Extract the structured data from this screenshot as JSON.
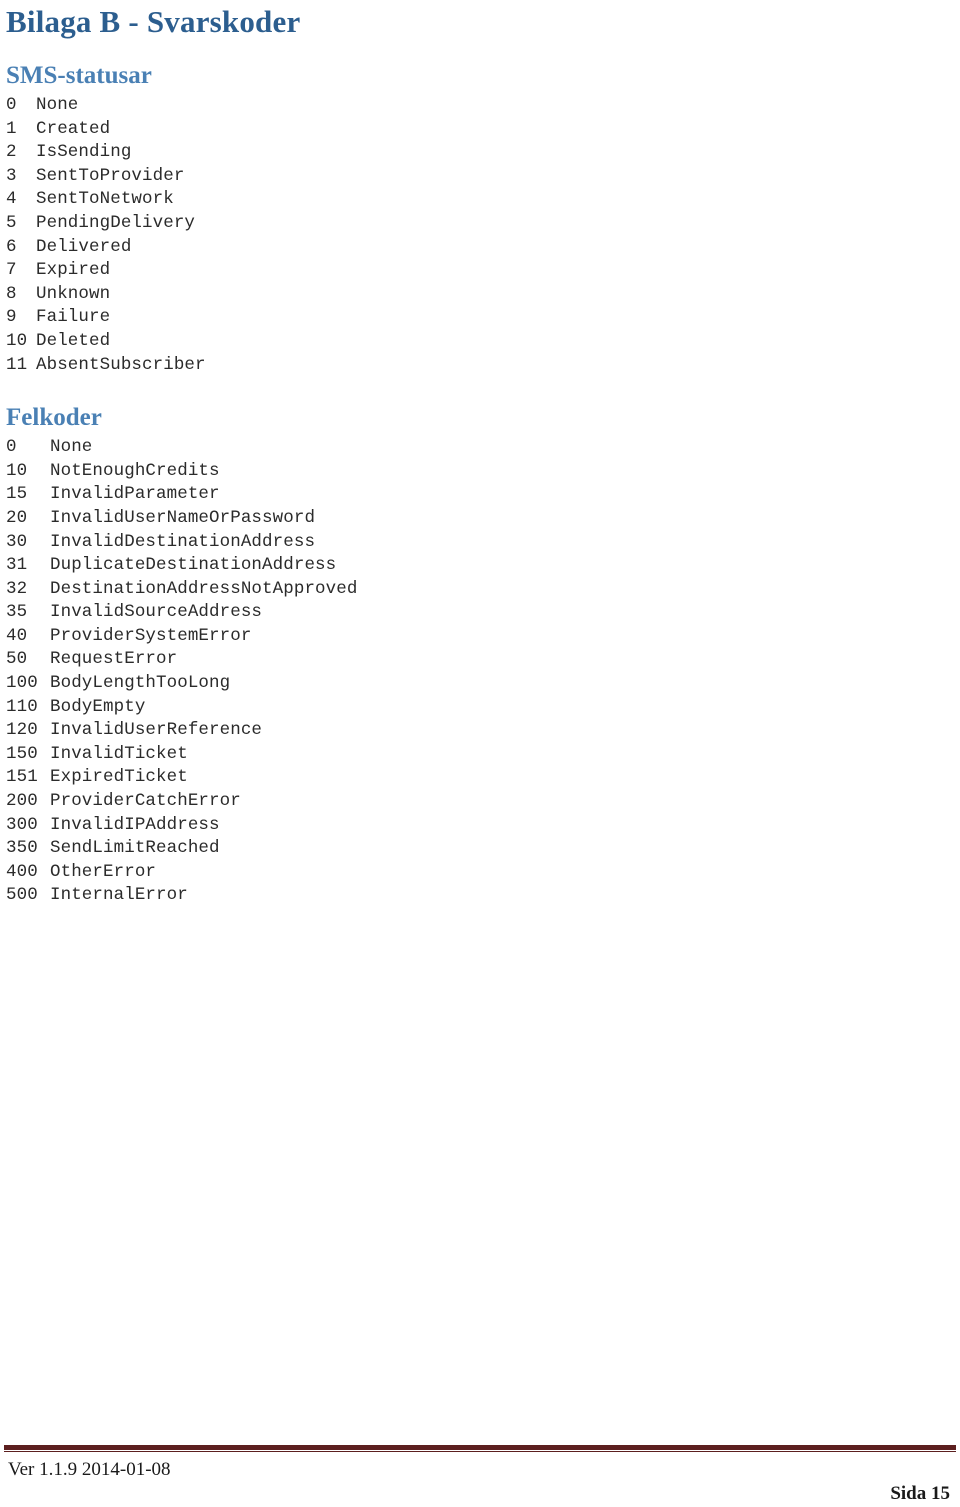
{
  "document": {
    "title": "Bilaga B - Svarskoder",
    "title_color": "#2C5E8F",
    "heading_color": "#4A80B4",
    "rule_color": "#5C1F1F"
  },
  "sections": [
    {
      "id": "sms-statusar",
      "heading": "SMS-statusar",
      "items": [
        {
          "code": "0",
          "label": "None"
        },
        {
          "code": "1",
          "label": "Created"
        },
        {
          "code": "2",
          "label": "IsSending"
        },
        {
          "code": "3",
          "label": "SentToProvider"
        },
        {
          "code": "4",
          "label": "SentToNetwork"
        },
        {
          "code": "5",
          "label": "PendingDelivery"
        },
        {
          "code": "6",
          "label": "Delivered"
        },
        {
          "code": "7",
          "label": "Expired"
        },
        {
          "code": "8",
          "label": "Unknown"
        },
        {
          "code": "9",
          "label": "Failure"
        },
        {
          "code": "10",
          "label": "Deleted"
        },
        {
          "code": "11",
          "label": "AbsentSubscriber"
        }
      ]
    },
    {
      "id": "felkoder",
      "heading": "Felkoder",
      "items": [
        {
          "code": "0",
          "label": "None"
        },
        {
          "code": "10",
          "label": "NotEnoughCredits"
        },
        {
          "code": "15",
          "label": "InvalidParameter"
        },
        {
          "code": "20",
          "label": "InvalidUserNameOrPassword"
        },
        {
          "code": "30",
          "label": "InvalidDestinationAddress"
        },
        {
          "code": "31",
          "label": "DuplicateDestinationAddress"
        },
        {
          "code": "32",
          "label": "DestinationAddressNotApproved"
        },
        {
          "code": "35",
          "label": "InvalidSourceAddress"
        },
        {
          "code": "40",
          "label": "ProviderSystemError"
        },
        {
          "code": "50",
          "label": "RequestError"
        },
        {
          "code": "100",
          "label": "BodyLengthTooLong"
        },
        {
          "code": "110",
          "label": "BodyEmpty"
        },
        {
          "code": "120",
          "label": "InvalidUserReference"
        },
        {
          "code": "150",
          "label": "InvalidTicket"
        },
        {
          "code": "151",
          "label": "ExpiredTicket"
        },
        {
          "code": "200",
          "label": "ProviderCatchError"
        },
        {
          "code": "300",
          "label": "InvalidIPAddress"
        },
        {
          "code": "350",
          "label": "SendLimitReached"
        },
        {
          "code": "400",
          "label": "OtherError"
        },
        {
          "code": "500",
          "label": "InternalError"
        }
      ]
    }
  ],
  "footer": {
    "version": "Ver 1.1.9 2014-01-08",
    "page_label": "Sida 15"
  }
}
